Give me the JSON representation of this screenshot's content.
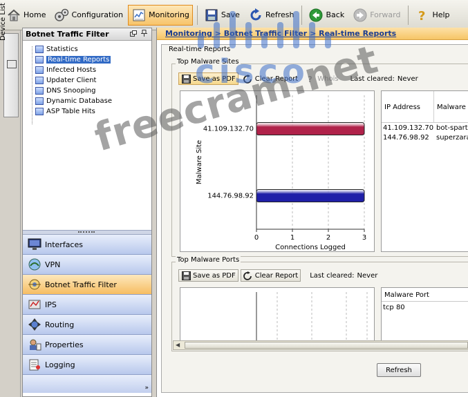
{
  "toolbar": {
    "home": "Home",
    "configuration": "Configuration",
    "monitoring": "Monitoring",
    "save": "Save",
    "refresh": "Refresh",
    "back": "Back",
    "forward": "Forward",
    "help": "Help"
  },
  "device_list_tab": "Device List",
  "left_panel": {
    "title": "Botnet Traffic Filter",
    "tree": [
      {
        "label": "Statistics"
      },
      {
        "label": "Real-time Reports"
      },
      {
        "label": "Infected Hosts"
      },
      {
        "label": "Updater Client"
      },
      {
        "label": "DNS Snooping"
      },
      {
        "label": "Dynamic Database"
      },
      {
        "label": "ASP Table Hits"
      }
    ],
    "selected_index": 1,
    "nav": [
      {
        "label": "Interfaces"
      },
      {
        "label": "VPN"
      },
      {
        "label": "Botnet Traffic Filter"
      },
      {
        "label": "IPS"
      },
      {
        "label": "Routing"
      },
      {
        "label": "Properties"
      },
      {
        "label": "Logging"
      }
    ],
    "active_nav": "Botnet Traffic Filter"
  },
  "breadcrumb": "Monitoring > Botnet Traffic Filter > Real-time Reports",
  "main": {
    "group_title": "Real-time Reports",
    "top_sites": {
      "title": "Top Malware Sites",
      "save_pdf": "Save as PDF",
      "clear_report": "Clear Report",
      "whois": "Whois",
      "last_cleared_label": "Last cleared:",
      "last_cleared_value": "Never",
      "table": {
        "columns": [
          "IP Address",
          "Malware"
        ],
        "rows": [
          [
            "41.109.132.70",
            "bot-sparta"
          ],
          [
            "144.76.98.92",
            "superzara"
          ]
        ]
      }
    },
    "top_ports": {
      "title": "Top Malware Ports",
      "save_pdf": "Save as PDF",
      "clear_report": "Clear Report",
      "last_cleared_label": "Last cleared:",
      "last_cleared_value": "Never",
      "table": {
        "columns": [
          "Malware Port"
        ],
        "rows": [
          [
            "tcp 80"
          ]
        ]
      }
    },
    "refresh_button": "Refresh"
  },
  "chart_data": {
    "type": "bar",
    "orientation": "horizontal",
    "categories": [
      "41.109.132.70",
      "144.76.98.92"
    ],
    "values": [
      3,
      3
    ],
    "colors": [
      "#b0224a",
      "#1f1fa8"
    ],
    "ylabel": "Malware Site",
    "xlabel": "Connections Logged",
    "xlim": [
      0,
      3
    ],
    "xticks": [
      "0",
      "1",
      "2",
      "3"
    ]
  },
  "watermark": {
    "brand": "cisco",
    "site": "freecram.net"
  },
  "colors": {
    "accent_orange": "#f6c566",
    "nav_blue": "#b8c8ec",
    "selection_blue": "#316ac5"
  }
}
